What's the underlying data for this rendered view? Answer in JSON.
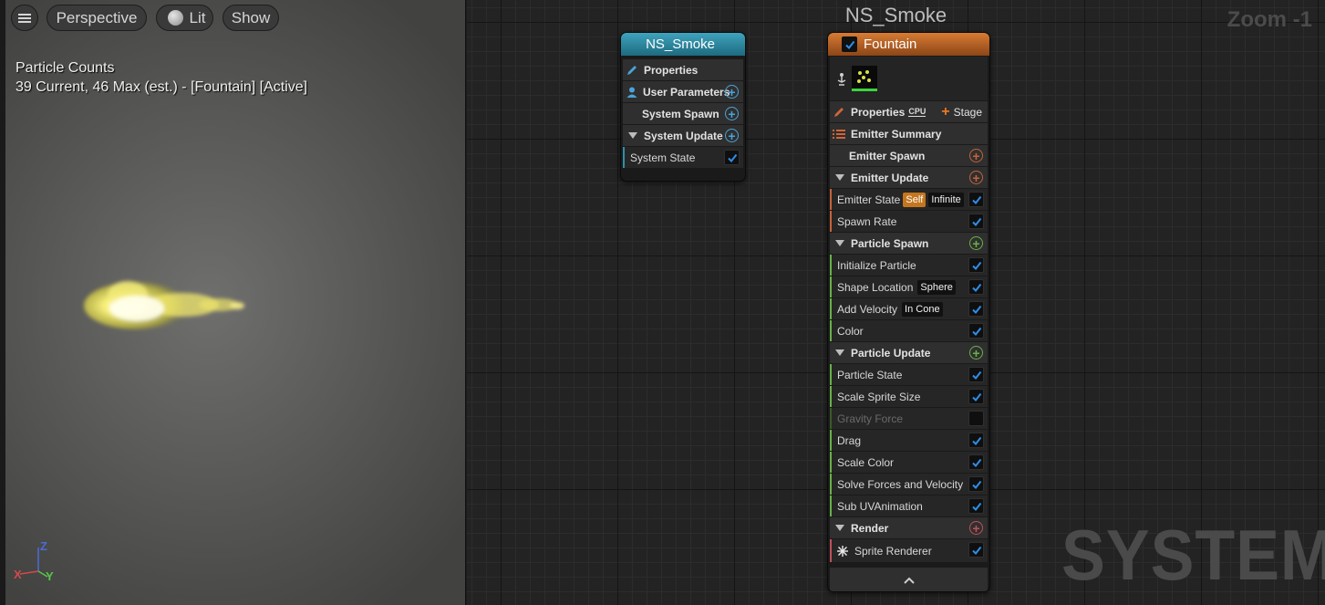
{
  "viewport": {
    "perspective_label": "Perspective",
    "lit_label": "Lit",
    "show_label": "Show",
    "particle_counts_title": "Particle Counts",
    "particle_counts_text": "39 Current, 46 Max (est.) - [Fountain] [Active]",
    "axis_z": "Z",
    "axis_y": "Y",
    "axis_x": "X"
  },
  "graph": {
    "title": "NS_Smoke",
    "zoom": "Zoom -1",
    "watermark": "SYSTEM"
  },
  "system_node": {
    "title": "NS_Smoke",
    "color": "#2f8fa8",
    "rows": {
      "properties": "Properties",
      "user_parameters": "User Parameters",
      "system_spawn": "System Spawn",
      "system_update": "System Update",
      "system_state": "System State"
    }
  },
  "emitter_node": {
    "title": "Fountain",
    "color": "#c0652a",
    "properties": "Properties",
    "sim_target": "CPU",
    "stage": "Stage",
    "emitter_summary": "Emitter Summary",
    "emitter_spawn": "Emitter Spawn",
    "emitter_update": {
      "label": "Emitter Update",
      "modules": [
        {
          "label": "Emitter State",
          "tags": [
            "Self",
            "Infinite"
          ],
          "enabled": true
        },
        {
          "label": "Spawn Rate",
          "enabled": true
        }
      ]
    },
    "particle_spawn": {
      "label": "Particle Spawn",
      "modules": [
        {
          "label": "Initialize Particle",
          "enabled": true
        },
        {
          "label": "Shape Location",
          "tag": "Sphere",
          "enabled": true
        },
        {
          "label": "Add Velocity",
          "tag": "In Cone",
          "enabled": true
        },
        {
          "label": "Color",
          "enabled": true
        }
      ]
    },
    "particle_update": {
      "label": "Particle Update",
      "modules": [
        {
          "label": "Particle State",
          "enabled": true
        },
        {
          "label": "Scale Sprite Size",
          "enabled": true
        },
        {
          "label": "Gravity Force",
          "enabled": false
        },
        {
          "label": "Drag",
          "enabled": true
        },
        {
          "label": "Scale Color",
          "enabled": true
        },
        {
          "label": "Solve Forces and Velocity",
          "enabled": true
        },
        {
          "label": "Sub UVAnimation",
          "enabled": true
        }
      ]
    },
    "render": {
      "label": "Render",
      "modules": [
        {
          "label": "Sprite Renderer",
          "enabled": true
        }
      ]
    }
  }
}
